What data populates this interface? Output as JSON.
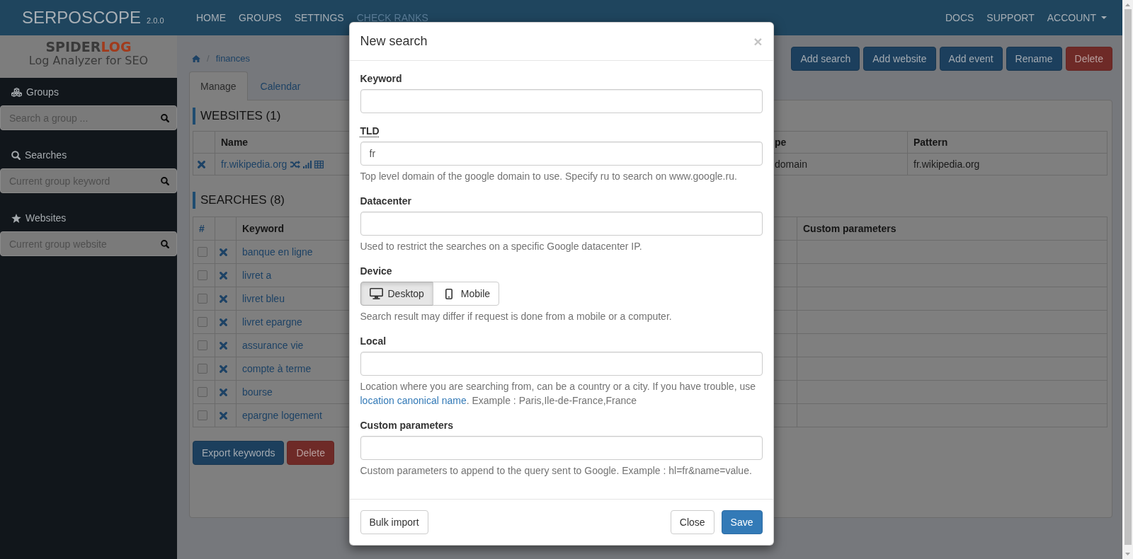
{
  "navbar": {
    "brand": "SERPOSCOPE",
    "version": "2.0.0",
    "links": [
      {
        "label": "HOME",
        "disabled": false
      },
      {
        "label": "GROUPS",
        "disabled": false
      },
      {
        "label": "SETTINGS",
        "disabled": false
      },
      {
        "label": "CHECK RANKS",
        "disabled": true
      }
    ],
    "right_links": [
      {
        "label": "DOCS",
        "kind": "link"
      },
      {
        "label": "SUPPORT",
        "kind": "link"
      },
      {
        "label": "ACCOUNT",
        "kind": "dropdown"
      }
    ]
  },
  "sidebar": {
    "logo": {
      "word": "SPIDER",
      "accent": "LOG",
      "tagline": "Log Analyzer for SEO"
    },
    "sections": [
      {
        "title": "Groups",
        "placeholder": "Search a group ..."
      },
      {
        "title": "Searches",
        "placeholder": "Current group keyword"
      },
      {
        "title": "Websites",
        "placeholder": "Current group website"
      }
    ]
  },
  "breadcrumb": {
    "separator": "/",
    "items": [
      "finances"
    ]
  },
  "actions": [
    {
      "label": "Add search",
      "kind": "primary"
    },
    {
      "label": "Add website",
      "kind": "primary"
    },
    {
      "label": "Add event",
      "kind": "primary"
    },
    {
      "label": "Rename",
      "kind": "primary"
    },
    {
      "label": "Delete",
      "kind": "danger"
    }
  ],
  "tabs": [
    {
      "label": "Manage",
      "selected": true
    },
    {
      "label": "Calendar",
      "selected": false
    }
  ],
  "websites": {
    "title": "WEBSITES (1)",
    "columns": [
      "Name",
      "pe",
      "Pattern"
    ],
    "rows": [
      {
        "name": "fr.wikipedia.org",
        "column_3": "domain",
        "pattern": "fr.wikipedia.org"
      }
    ]
  },
  "searches": {
    "title": "SEARCHES (8)",
    "columns": [
      "#",
      "Keyword",
      "Custom parameters"
    ],
    "rows": [
      {
        "keyword": "banque en ligne",
        "checked": false
      },
      {
        "keyword": "livret a",
        "checked": false
      },
      {
        "keyword": "livret bleu",
        "checked": false
      },
      {
        "keyword": "livret epargne",
        "checked": false
      },
      {
        "keyword": "assurance vie",
        "checked": false
      },
      {
        "keyword": "compte à terme",
        "checked": false
      },
      {
        "keyword": "bourse",
        "checked": false
      },
      {
        "keyword": "epargne logement",
        "checked": false
      }
    ]
  },
  "search_buttons": [
    {
      "label": "Export keywords",
      "kind": "primary"
    },
    {
      "label": "Delete",
      "kind": "danger"
    }
  ],
  "modal": {
    "title": "New search",
    "close": "×",
    "fields": [
      {
        "label": "Keyword",
        "kind": "input",
        "abbr": false
      },
      {
        "label": "TLD",
        "kind": "input",
        "abbr": true,
        "value": "fr",
        "help": "Top level domain of the google domain to use. Specify ru to search on www.google.ru."
      },
      {
        "label": "Datacenter",
        "kind": "input",
        "abbr": false,
        "help": "Used to restrict the searches on a specific Google datacenter IP."
      },
      {
        "label": "Device",
        "kind": "toggle",
        "abbr": false,
        "options": [
          {
            "label": "Desktop",
            "selected": true
          },
          {
            "label": "Mobile",
            "selected": false
          }
        ],
        "help": "Search result may differ if request is done from a mobile or a computer."
      },
      {
        "label": "Local",
        "kind": "input",
        "abbr": false,
        "help": "Location where you are searching from, can be a country or a city. If you have trouble, use",
        "help_link": "location canonical name",
        "help_after": ". Example : Paris,Ile-de-France,France"
      },
      {
        "label": "Custom parameters",
        "kind": "input",
        "abbr": false,
        "help": "Custom parameters to append to the query sent to Google. Example : hl=fr&name=value."
      }
    ],
    "footer_left": [
      {
        "label": "Bulk import",
        "kind": "default"
      }
    ],
    "footer_right": [
      {
        "label": "Close",
        "kind": "default"
      },
      {
        "label": "Save",
        "kind": "primary"
      }
    ]
  }
}
